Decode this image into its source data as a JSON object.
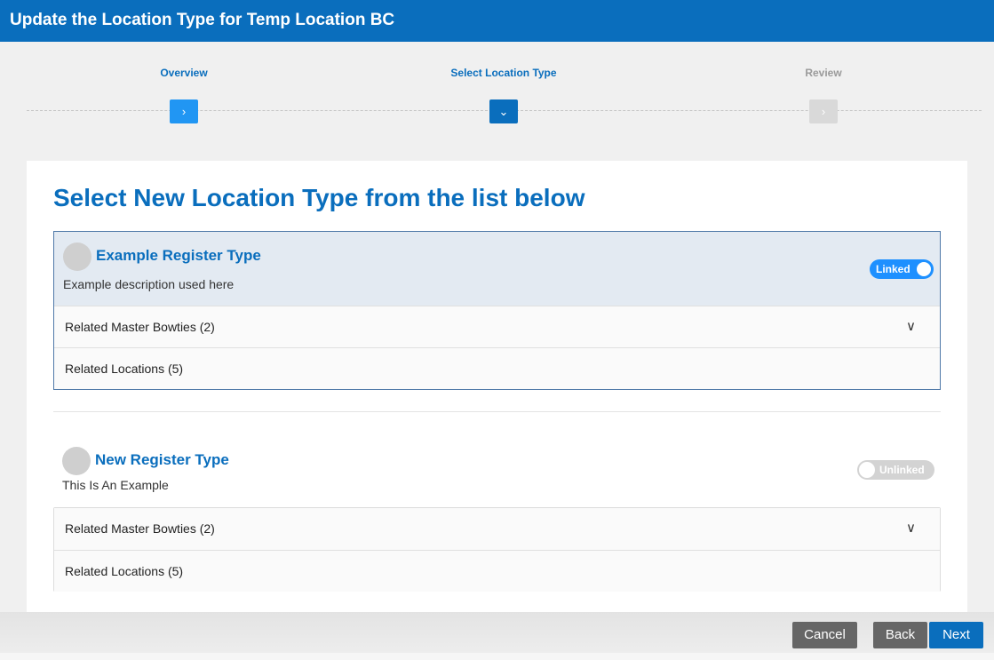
{
  "window": {
    "title": "Update the Location Type for Temp Location BC"
  },
  "stepper": {
    "steps": [
      {
        "label": "Overview",
        "state": "completed",
        "icon": "chevron-right-icon",
        "glyph": "›"
      },
      {
        "label": "Select Location Type",
        "state": "active",
        "icon": "chevron-down-icon",
        "glyph": "⌄"
      },
      {
        "label": "Review",
        "state": "upcoming",
        "icon": "chevron-right-icon",
        "glyph": "›"
      }
    ]
  },
  "main": {
    "heading": "Select New Location Type from the list below",
    "cards": [
      {
        "name": "Example Register Type",
        "description": "Example description used here",
        "toggle": "Linked",
        "selected": true,
        "related_bowties": "Related Master Bowties (2)",
        "related_locations": "Related Locations (5)"
      },
      {
        "name": "New Register Type",
        "description": "This Is An Example",
        "toggle": "Unlinked",
        "selected": false,
        "related_bowties": "Related Master Bowties (2)",
        "related_locations": "Related Locations (5)"
      }
    ],
    "chevron_glyph": "∨"
  },
  "footer": {
    "cancel": "Cancel",
    "back": "Back",
    "next": "Next"
  },
  "colors": {
    "primary": "#0a6ebd",
    "toggle_on": "#1e90ff",
    "toggle_off": "#d3d3d3",
    "button_gray": "#666666"
  }
}
